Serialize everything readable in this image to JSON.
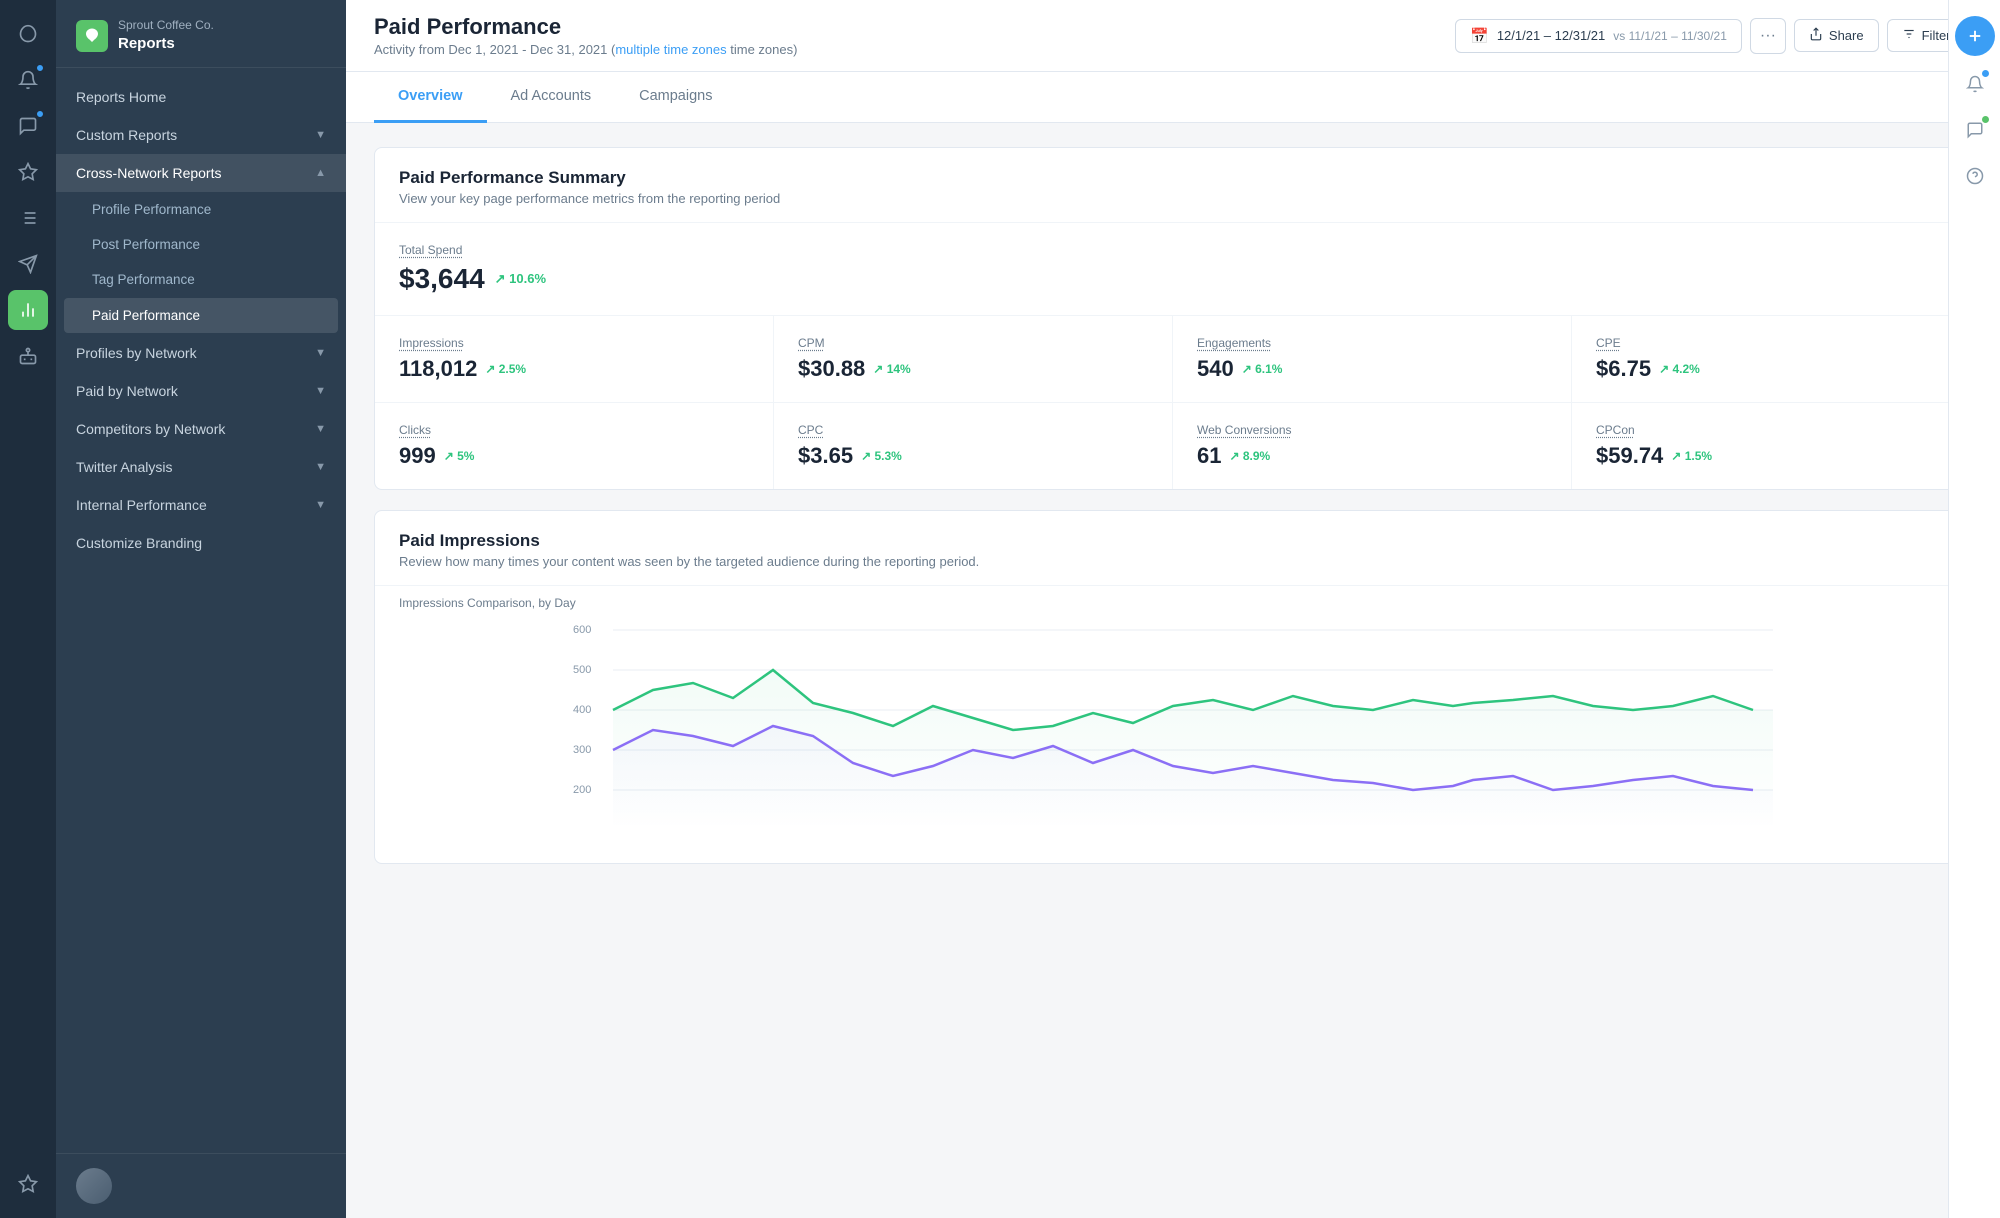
{
  "brand": {
    "company": "Sprout Coffee Co.",
    "app": "Reports"
  },
  "iconStrip": {
    "items": [
      {
        "name": "leaf-icon",
        "symbol": "🌿",
        "active": false
      },
      {
        "name": "bell-icon",
        "symbol": "🔔",
        "active": false,
        "badge": true
      },
      {
        "name": "chat-icon",
        "symbol": "💬",
        "active": false,
        "badge": true
      },
      {
        "name": "help-icon",
        "symbol": "?",
        "active": false
      }
    ],
    "activeItem": {
      "name": "chart-icon",
      "symbol": "📊",
      "active": true
    }
  },
  "sidebar": {
    "reportsHome": "Reports Home",
    "customReports": "Custom Reports",
    "crossNetworkReports": "Cross-Network Reports",
    "subItems": [
      {
        "label": "Profile Performance",
        "active": false
      },
      {
        "label": "Post Performance",
        "active": false
      },
      {
        "label": "Tag Performance",
        "active": false
      },
      {
        "label": "Paid Performance",
        "active": true
      }
    ],
    "networkSections": [
      {
        "label": "Profiles by Network",
        "expanded": false
      },
      {
        "label": "Paid by Network",
        "expanded": false
      },
      {
        "label": "Competitors by Network",
        "expanded": false
      },
      {
        "label": "Twitter Analysis",
        "expanded": false
      },
      {
        "label": "Internal Performance",
        "expanded": false
      }
    ],
    "customizeBranding": "Customize Branding"
  },
  "header": {
    "title": "Paid Performance",
    "subtitle": "Activity from Dec 1, 2021 - Dec 31, 2021",
    "timezoneLink": "multiple time zones",
    "dateRange": "12/1/21 – 12/31/21",
    "vsRange": "vs 11/1/21 – 11/30/21",
    "shareLabel": "Share",
    "filtersLabel": "Filters"
  },
  "tabs": [
    {
      "label": "Overview",
      "active": true
    },
    {
      "label": "Ad Accounts",
      "active": false
    },
    {
      "label": "Campaigns",
      "active": false
    }
  ],
  "summary": {
    "cardTitle": "Paid Performance Summary",
    "cardSubtitle": "View your key page performance metrics from the reporting period",
    "totalSpend": {
      "label": "Total Spend",
      "value": "$3,644",
      "change": "10.6%"
    },
    "metrics": [
      {
        "label": "Impressions",
        "value": "118,012",
        "change": "2.5%"
      },
      {
        "label": "CPM",
        "value": "$30.88",
        "change": "14%"
      },
      {
        "label": "Engagements",
        "value": "540",
        "change": "6.1%"
      },
      {
        "label": "CPE",
        "value": "$6.75",
        "change": "4.2%"
      },
      {
        "label": "Clicks",
        "value": "999",
        "change": "5%"
      },
      {
        "label": "CPC",
        "value": "$3.65",
        "change": "5.3%"
      },
      {
        "label": "Web Conversions",
        "value": "61",
        "change": "8.9%"
      },
      {
        "label": "CPCon",
        "value": "$59.74",
        "change": "1.5%"
      }
    ]
  },
  "impressionsChart": {
    "title": "Paid Impressions",
    "subtitle": "Review how many times your content was seen by the targeted audience during the reporting period.",
    "chartLabel": "Impressions Comparison, by Day",
    "yAxisLabels": [
      "600",
      "500",
      "400",
      "300",
      "200"
    ],
    "colors": {
      "teal": "#2ec47e",
      "purple": "#8b6ff5"
    }
  }
}
